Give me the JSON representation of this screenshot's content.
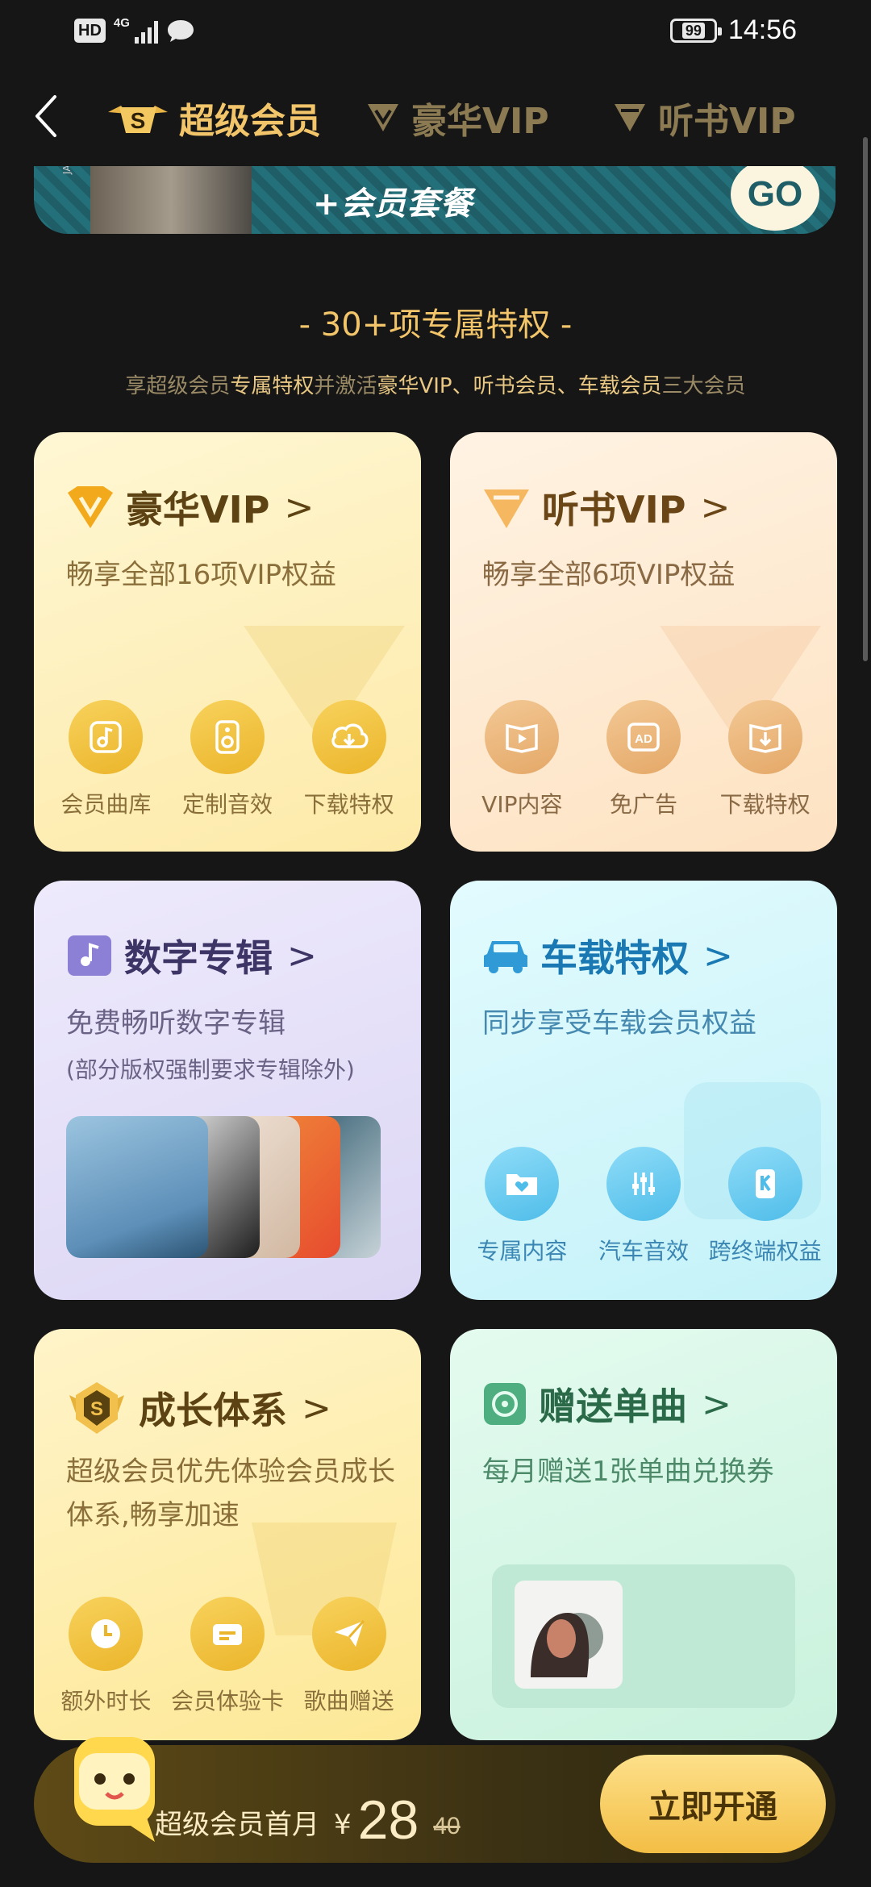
{
  "status_bar": {
    "hd": "HD",
    "network": "4G",
    "battery": "99",
    "time": "14:56"
  },
  "nav": {
    "tabs": [
      {
        "label": "超级会员",
        "active": true,
        "icon": "super-badge-icon"
      },
      {
        "label": "豪华VIP",
        "active": false,
        "icon": "diamond-icon"
      },
      {
        "label": "听书VIP",
        "active": false,
        "icon": "diamond-icon"
      }
    ]
  },
  "banner": {
    "text": "+会员套餐",
    "side_text": "JAY CHOU",
    "go": "GO"
  },
  "section": {
    "title": "- 30+项专属特权 -",
    "sub_parts": [
      "享超级会员",
      "专属特权",
      "并激活",
      "豪华VIP、听书会员、车载会员",
      "三大会员"
    ]
  },
  "cards": [
    {
      "title": "豪华VIP",
      "desc": "畅享全部16项VIP权益",
      "features": [
        {
          "label": "会员曲库",
          "icon": "music-note-icon"
        },
        {
          "label": "定制音效",
          "icon": "speaker-icon"
        },
        {
          "label": "下载特权",
          "icon": "cloud-download-icon"
        }
      ]
    },
    {
      "title": "听书VIP",
      "desc": "畅享全部6项VIP权益",
      "features": [
        {
          "label": "VIP内容",
          "icon": "play-book-icon"
        },
        {
          "label": "免广告",
          "icon": "ad-free-icon"
        },
        {
          "label": "下载特权",
          "icon": "download-book-icon"
        }
      ]
    },
    {
      "title": "数字专辑",
      "desc": "免费畅听数字专辑",
      "note": "(部分版权强制要求专辑除外)"
    },
    {
      "title": "车载特权",
      "desc": "同步享受车载会员权益",
      "features": [
        {
          "label": "专属内容",
          "icon": "folder-heart-icon"
        },
        {
          "label": "汽车音效",
          "icon": "equalizer-icon"
        },
        {
          "label": "跨终端权益",
          "icon": "device-sync-icon"
        }
      ]
    },
    {
      "title": "成长体系",
      "desc": "超级会员优先体验会员成长体系,畅享加速",
      "features": [
        {
          "label": "额外时长",
          "icon": "clock-icon"
        },
        {
          "label": "会员体验卡",
          "icon": "card-icon"
        },
        {
          "label": "歌曲赠送",
          "icon": "send-icon"
        }
      ]
    },
    {
      "title": "赠送单曲",
      "desc": "每月赠送1张单曲兑换券"
    }
  ],
  "bottom": {
    "label": "超级会员首月",
    "yen": "¥",
    "price": "28",
    "original": "40",
    "button": "立即开通"
  },
  "colors": {
    "background": "#161616",
    "gold": "#f2c56a",
    "teal_banner": "#1f5e67"
  }
}
